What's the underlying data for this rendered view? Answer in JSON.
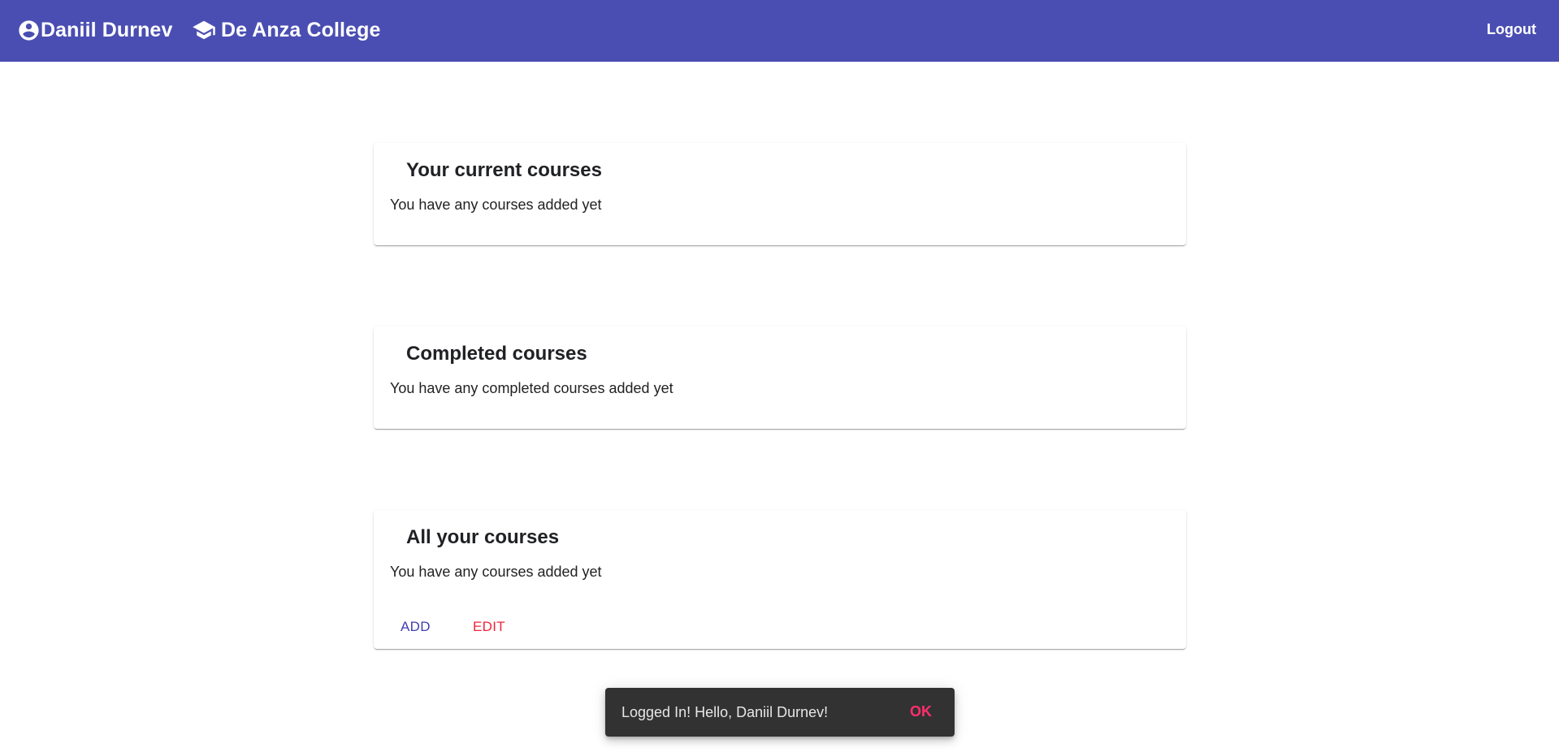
{
  "appbar": {
    "user_name": "Daniil Durnev",
    "college_name": "De Anza College",
    "logout_label": "Logout",
    "user_icon": "account-circle-icon",
    "college_icon": "graduation-cap-icon"
  },
  "cards": {
    "current": {
      "title": "Your current courses",
      "message": "You have any courses added yet"
    },
    "completed": {
      "title": "Completed courses",
      "message": "You have any completed courses added yet"
    },
    "all": {
      "title": "All your courses",
      "message": "You have any courses added yet",
      "add_label": "ADD",
      "edit_label": "EDIT"
    }
  },
  "snackbar": {
    "message": "Logged In! Hello, Daniil Durnev!",
    "action_label": "OK"
  },
  "colors": {
    "primary": "#4a4eb2",
    "secondary": "#f0253c",
    "snackbar_action": "#ff2f6d"
  }
}
